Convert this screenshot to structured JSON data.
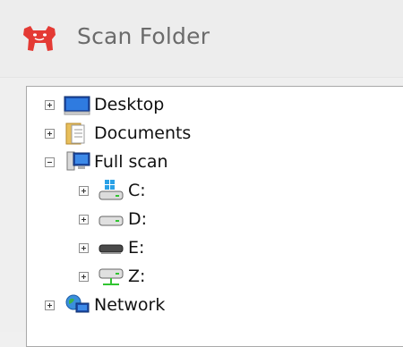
{
  "header": {
    "title": "Scan Folder",
    "logo_icon": "bulldog-logo-icon",
    "accent": "#e43a34"
  },
  "tree": {
    "items": [
      {
        "label": "Desktop",
        "icon": "desktop-icon",
        "state": "collapsed",
        "level": 0
      },
      {
        "label": "Documents",
        "icon": "documents-folder-icon",
        "state": "collapsed",
        "level": 0
      },
      {
        "label": "Full scan",
        "icon": "computer-icon",
        "state": "expanded",
        "level": 0
      },
      {
        "label": "C:",
        "icon": "windows-drive-icon",
        "state": "collapsed",
        "level": 1
      },
      {
        "label": "D:",
        "icon": "drive-icon",
        "state": "collapsed",
        "level": 1
      },
      {
        "label": "E:",
        "icon": "removable-drive-icon",
        "state": "collapsed",
        "level": 1
      },
      {
        "label": "Z:",
        "icon": "network-drive-icon",
        "state": "collapsed",
        "level": 1
      },
      {
        "label": "Network",
        "icon": "network-icon",
        "state": "collapsed",
        "level": 0
      }
    ]
  }
}
